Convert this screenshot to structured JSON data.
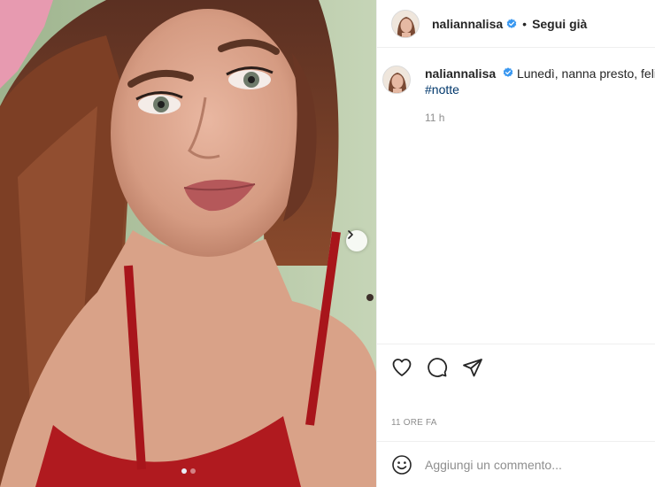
{
  "post": {
    "username": "naliannalisa",
    "follow_label": "Segui già",
    "separator": "•",
    "caption": "Lunedì, nanna presto, felicità",
    "hashtag": "#notte",
    "caption_time": "11 h",
    "posted_ago": "11 ORE FA",
    "carousel": {
      "current": 1,
      "total": 2
    }
  },
  "comment": {
    "placeholder": "Aggiungi un commento..."
  },
  "icons": {
    "verified": "verified-badge-icon",
    "like": "heart-icon",
    "comment": "comment-bubble-icon",
    "share": "paper-plane-icon",
    "emoji": "emoji-smile-icon",
    "next": "chevron-right-icon"
  },
  "colors": {
    "verified": "#3897f0",
    "text": "#262626",
    "secondary": "#8e8e8e",
    "hashtag": "#00376b"
  }
}
